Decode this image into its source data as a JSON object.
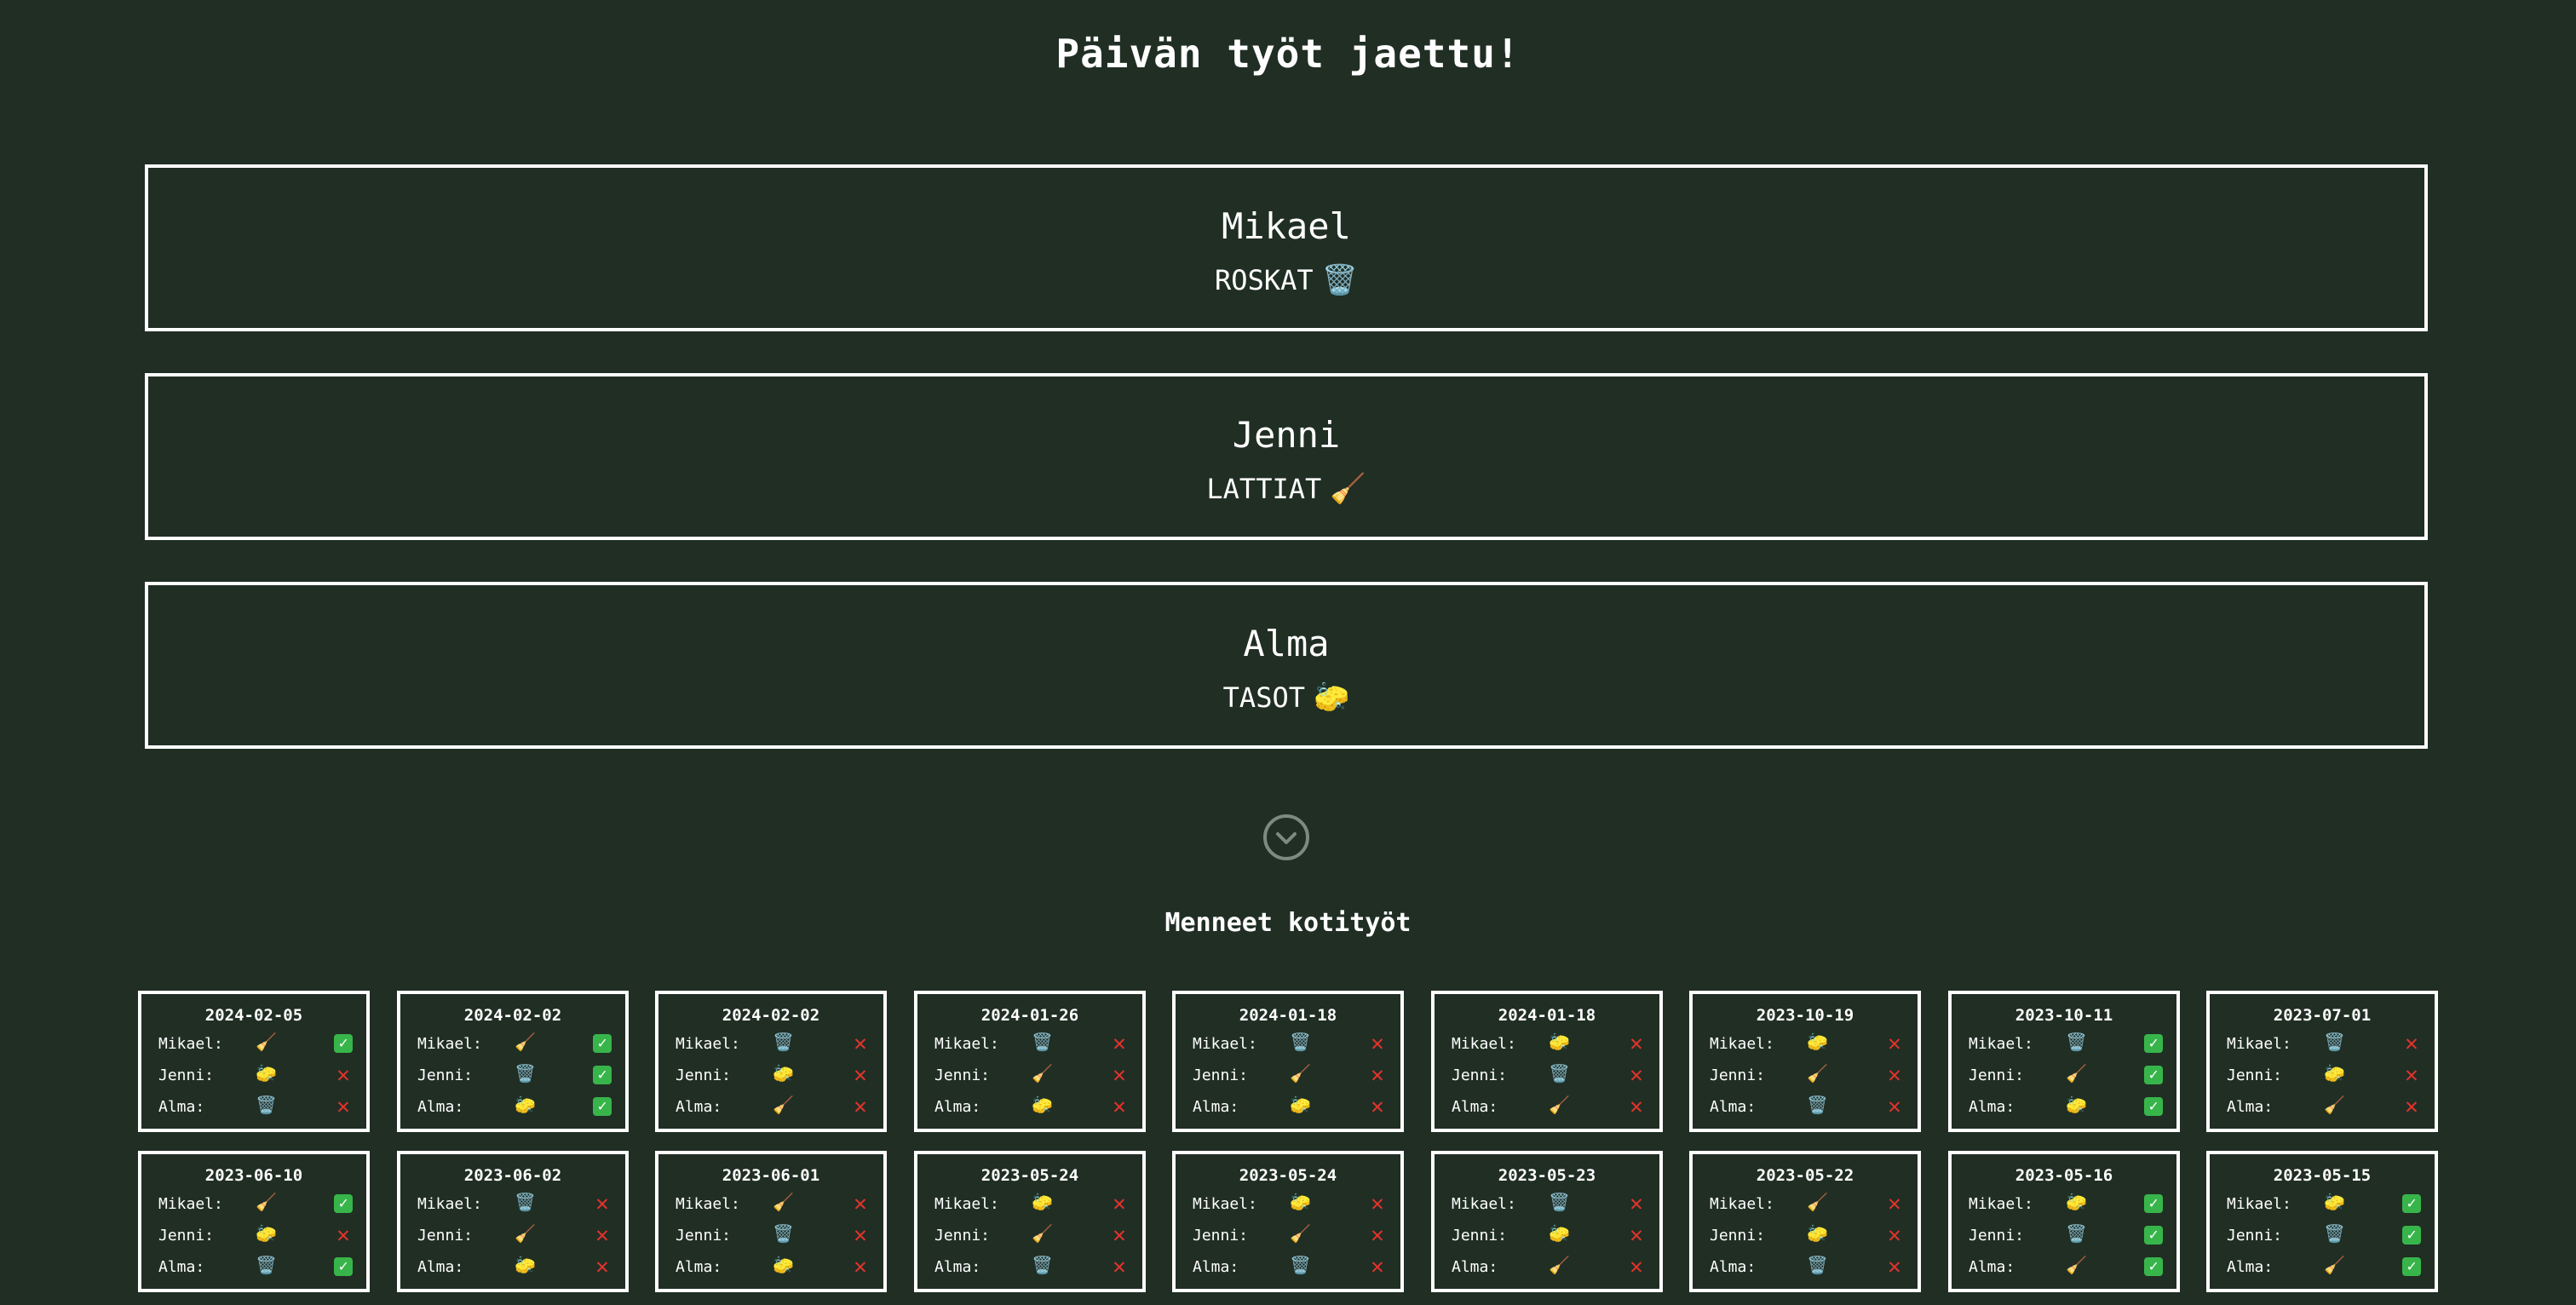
{
  "title": "Päivän työt jaettu!",
  "assignments": [
    {
      "name": "Mikael",
      "task": "ROSKAT",
      "emoji": "🗑️"
    },
    {
      "name": "Jenni",
      "task": "LATTIAT",
      "emoji": "🧹"
    },
    {
      "name": "Alma",
      "task": "TASOT",
      "emoji": "🧽"
    }
  ],
  "expand_icon": "chevron-down-icon",
  "past_title": "Menneet kotityöt",
  "past": [
    {
      "date": "2024-02-05",
      "rows": [
        {
          "who": "Mikael:",
          "chore": "🧹",
          "done": true
        },
        {
          "who": "Jenni:",
          "chore": "🧽",
          "done": false
        },
        {
          "who": "Alma:",
          "chore": "🗑️",
          "done": false
        }
      ]
    },
    {
      "date": "2024-02-02",
      "rows": [
        {
          "who": "Mikael:",
          "chore": "🧹",
          "done": true
        },
        {
          "who": "Jenni:",
          "chore": "🗑️",
          "done": true
        },
        {
          "who": "Alma:",
          "chore": "🧽",
          "done": true
        }
      ]
    },
    {
      "date": "2024-02-02",
      "rows": [
        {
          "who": "Mikael:",
          "chore": "🗑️",
          "done": false
        },
        {
          "who": "Jenni:",
          "chore": "🧽",
          "done": false
        },
        {
          "who": "Alma:",
          "chore": "🧹",
          "done": false
        }
      ]
    },
    {
      "date": "2024-01-26",
      "rows": [
        {
          "who": "Mikael:",
          "chore": "🗑️",
          "done": false
        },
        {
          "who": "Jenni:",
          "chore": "🧹",
          "done": false
        },
        {
          "who": "Alma:",
          "chore": "🧽",
          "done": false
        }
      ]
    },
    {
      "date": "2024-01-18",
      "rows": [
        {
          "who": "Mikael:",
          "chore": "🗑️",
          "done": false
        },
        {
          "who": "Jenni:",
          "chore": "🧹",
          "done": false
        },
        {
          "who": "Alma:",
          "chore": "🧽",
          "done": false
        }
      ]
    },
    {
      "date": "2024-01-18",
      "rows": [
        {
          "who": "Mikael:",
          "chore": "🧽",
          "done": false
        },
        {
          "who": "Jenni:",
          "chore": "🗑️",
          "done": false
        },
        {
          "who": "Alma:",
          "chore": "🧹",
          "done": false
        }
      ]
    },
    {
      "date": "2023-10-19",
      "rows": [
        {
          "who": "Mikael:",
          "chore": "🧽",
          "done": false
        },
        {
          "who": "Jenni:",
          "chore": "🧹",
          "done": false
        },
        {
          "who": "Alma:",
          "chore": "🗑️",
          "done": false
        }
      ]
    },
    {
      "date": "2023-10-11",
      "rows": [
        {
          "who": "Mikael:",
          "chore": "🗑️",
          "done": true
        },
        {
          "who": "Jenni:",
          "chore": "🧹",
          "done": true
        },
        {
          "who": "Alma:",
          "chore": "🧽",
          "done": true
        }
      ]
    },
    {
      "date": "2023-07-01",
      "rows": [
        {
          "who": "Mikael:",
          "chore": "🗑️",
          "done": false
        },
        {
          "who": "Jenni:",
          "chore": "🧽",
          "done": false
        },
        {
          "who": "Alma:",
          "chore": "🧹",
          "done": false
        }
      ]
    },
    {
      "date": "2023-06-10",
      "rows": [
        {
          "who": "Mikael:",
          "chore": "🧹",
          "done": true
        },
        {
          "who": "Jenni:",
          "chore": "🧽",
          "done": false
        },
        {
          "who": "Alma:",
          "chore": "🗑️",
          "done": true
        }
      ]
    },
    {
      "date": "2023-06-02",
      "rows": [
        {
          "who": "Mikael:",
          "chore": "🗑️",
          "done": false
        },
        {
          "who": "Jenni:",
          "chore": "🧹",
          "done": false
        },
        {
          "who": "Alma:",
          "chore": "🧽",
          "done": false
        }
      ]
    },
    {
      "date": "2023-06-01",
      "rows": [
        {
          "who": "Mikael:",
          "chore": "🧹",
          "done": false
        },
        {
          "who": "Jenni:",
          "chore": "🗑️",
          "done": false
        },
        {
          "who": "Alma:",
          "chore": "🧽",
          "done": false
        }
      ]
    },
    {
      "date": "2023-05-24",
      "rows": [
        {
          "who": "Mikael:",
          "chore": "🧽",
          "done": false
        },
        {
          "who": "Jenni:",
          "chore": "🧹",
          "done": false
        },
        {
          "who": "Alma:",
          "chore": "🗑️",
          "done": false
        }
      ]
    },
    {
      "date": "2023-05-24",
      "rows": [
        {
          "who": "Mikael:",
          "chore": "🧽",
          "done": false
        },
        {
          "who": "Jenni:",
          "chore": "🧹",
          "done": false
        },
        {
          "who": "Alma:",
          "chore": "🗑️",
          "done": false
        }
      ]
    },
    {
      "date": "2023-05-23",
      "rows": [
        {
          "who": "Mikael:",
          "chore": "🗑️",
          "done": false
        },
        {
          "who": "Jenni:",
          "chore": "🧽",
          "done": false
        },
        {
          "who": "Alma:",
          "chore": "🧹",
          "done": false
        }
      ]
    },
    {
      "date": "2023-05-22",
      "rows": [
        {
          "who": "Mikael:",
          "chore": "🧹",
          "done": false
        },
        {
          "who": "Jenni:",
          "chore": "🧽",
          "done": false
        },
        {
          "who": "Alma:",
          "chore": "🗑️",
          "done": false
        }
      ]
    },
    {
      "date": "2023-05-16",
      "rows": [
        {
          "who": "Mikael:",
          "chore": "🧽",
          "done": true
        },
        {
          "who": "Jenni:",
          "chore": "🗑️",
          "done": true
        },
        {
          "who": "Alma:",
          "chore": "🧹",
          "done": true
        }
      ]
    },
    {
      "date": "2023-05-15",
      "rows": [
        {
          "who": "Mikael:",
          "chore": "🧽",
          "done": true
        },
        {
          "who": "Jenni:",
          "chore": "🗑️",
          "done": true
        },
        {
          "who": "Alma:",
          "chore": "🧹",
          "done": true
        }
      ]
    }
  ],
  "status_glyphs": {
    "done": "✓",
    "not_done": "✕"
  },
  "colors": {
    "background": "#202e24",
    "check": "#38b54a",
    "cross": "#e0332c"
  }
}
